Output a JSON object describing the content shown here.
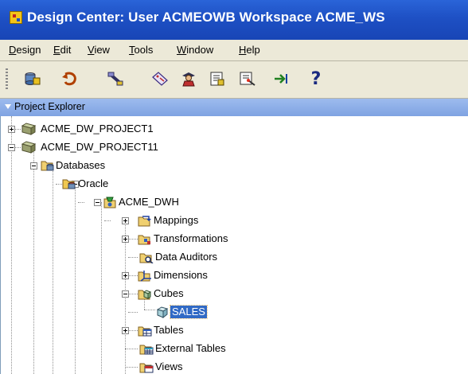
{
  "window": {
    "title": "Design Center: User ACMEOWB   Workspace ACME_WS",
    "app_icon": "design-center-icon"
  },
  "menu": [
    {
      "label": "Design",
      "mnemonic": "D"
    },
    {
      "label": "Edit",
      "mnemonic": "E"
    },
    {
      "label": "View",
      "mnemonic": "V"
    },
    {
      "label": "Tools",
      "mnemonic": "T"
    },
    {
      "label": "Window",
      "mnemonic": "W"
    },
    {
      "label": "Help",
      "mnemonic": "H"
    }
  ],
  "toolbar": [
    {
      "icon": "deploy-icon"
    },
    {
      "icon": "undo-icon"
    },
    {
      "icon": "connect-icon"
    },
    {
      "icon": "tag-icon"
    },
    {
      "icon": "user-icon"
    },
    {
      "icon": "template-icon"
    },
    {
      "icon": "wizard-icon"
    },
    {
      "icon": "goto-icon"
    },
    {
      "icon": "help-icon",
      "label": "?"
    }
  ],
  "project_explorer": {
    "title": "Project Explorer",
    "nodes": {
      "p1": {
        "label": "ACME_DW_PROJECT1",
        "icon": "project-icon",
        "state": "collapsed"
      },
      "p11": {
        "label": "ACME_DW_PROJECT11",
        "icon": "project-icon",
        "state": "expanded"
      },
      "databases": {
        "label": "Databases",
        "icon": "databases-folder-icon",
        "state": "expanded"
      },
      "oracle": {
        "label": "Oracle",
        "icon": "oracle-folder-icon",
        "state": "expanded"
      },
      "acme_dwh": {
        "label": "ACME_DWH",
        "icon": "module-icon",
        "state": "expanded"
      },
      "mappings": {
        "label": "Mappings",
        "icon": "mappings-icon",
        "state": "collapsed"
      },
      "transformations": {
        "label": "Transformations",
        "icon": "transformations-icon",
        "state": "collapsed"
      },
      "data_auditors": {
        "label": "Data Auditors",
        "icon": "data-auditors-icon",
        "state": "leaf"
      },
      "dimensions": {
        "label": "Dimensions",
        "icon": "dimensions-icon",
        "state": "collapsed"
      },
      "cubes": {
        "label": "Cubes",
        "icon": "cubes-folder-icon",
        "state": "expanded"
      },
      "sales": {
        "label": "SALES",
        "icon": "cube-icon",
        "state": "leaf",
        "selected": true
      },
      "tables": {
        "label": "Tables",
        "icon": "tables-icon",
        "state": "collapsed"
      },
      "external_tables": {
        "label": "External Tables",
        "icon": "external-tables-icon",
        "state": "leaf"
      },
      "views": {
        "label": "Views",
        "icon": "views-icon",
        "state": "leaf"
      }
    }
  }
}
